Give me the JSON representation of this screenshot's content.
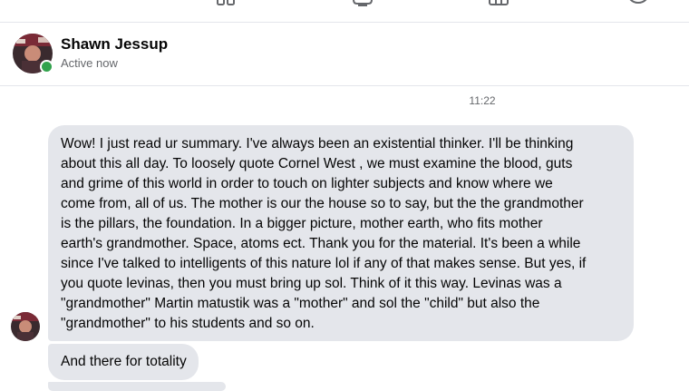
{
  "header": {
    "contact_name": "Shawn Jessup",
    "status": "Active now"
  },
  "top_nav": {
    "icons": [
      "columns-icon",
      "inbox-icon",
      "grid-icon",
      "circle-icon"
    ]
  },
  "conversation": {
    "timestamp": "11:22",
    "messages": [
      {
        "sender": "Shawn Jessup",
        "text": "Wow! I just read ur summary. I've always been an existential thinker. I'll be thinking\nabout this all day. To loosely quote Cornel West , we must examine the blood, guts\nand grime of this world in order to touch on lighter subjects and know where we\ncome from, all of us. The mother is our the house so to say, but the the grandmother\nis the pillars, the foundation. In a bigger picture, mother earth, who fits mother\nearth's grandmother. Space,  atoms ect. Thank you for the material. It's been a while\nsince I've talked to intelligents of this nature lol if any of that makes sense. But yes, if\nyou quote levinas, then you must bring up sol. Think of it this way. Levinas was a\n\"grandmother\" Martin matustik was a \"mother\" and sol the \"child\" but also the\n\"grandmother\" to his students and so on."
      },
      {
        "sender": "Shawn Jessup",
        "text": "And there for totality"
      }
    ]
  },
  "colors": {
    "bubble_bg": "#e4e6eb",
    "online": "#31a24c",
    "secondary_text": "#65676b"
  }
}
